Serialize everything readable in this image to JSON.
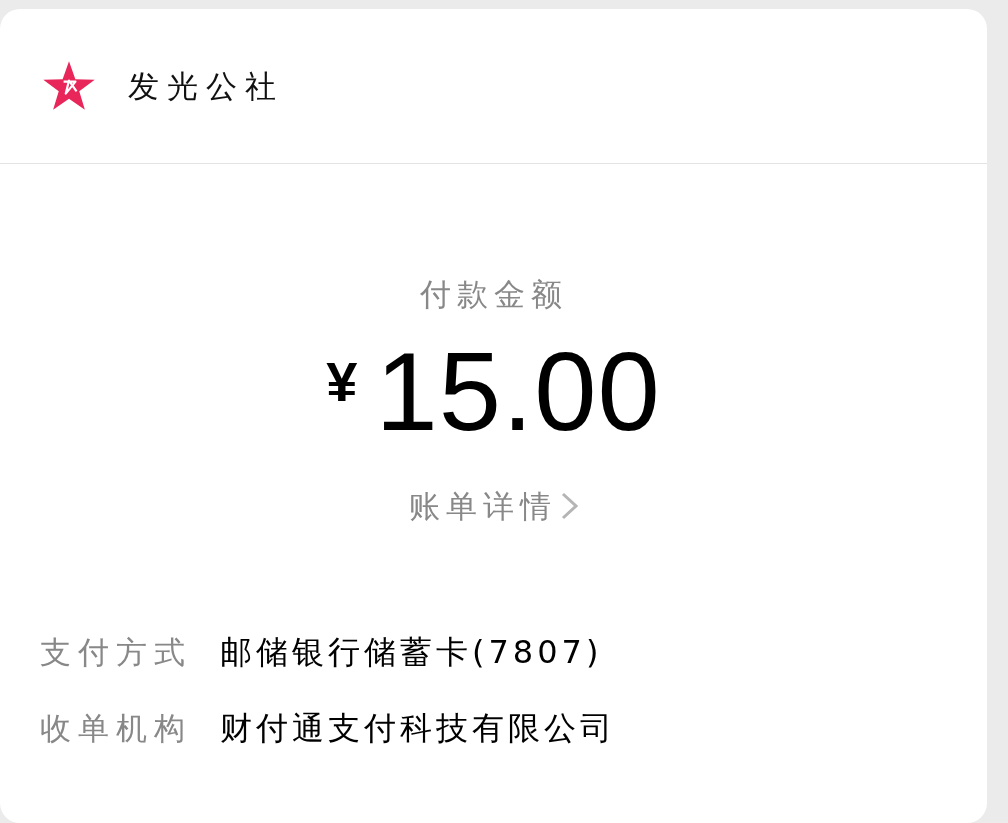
{
  "header": {
    "merchant_name": "发光公社"
  },
  "payment": {
    "label": "付款金额",
    "currency": "¥",
    "amount": "15.00",
    "details_link": "账单详情"
  },
  "info_rows": [
    {
      "label": "支付方式",
      "value": "邮储银行储蓄卡(7807)"
    },
    {
      "label": "收单机构",
      "value": "财付通支付科技有限公司"
    }
  ]
}
